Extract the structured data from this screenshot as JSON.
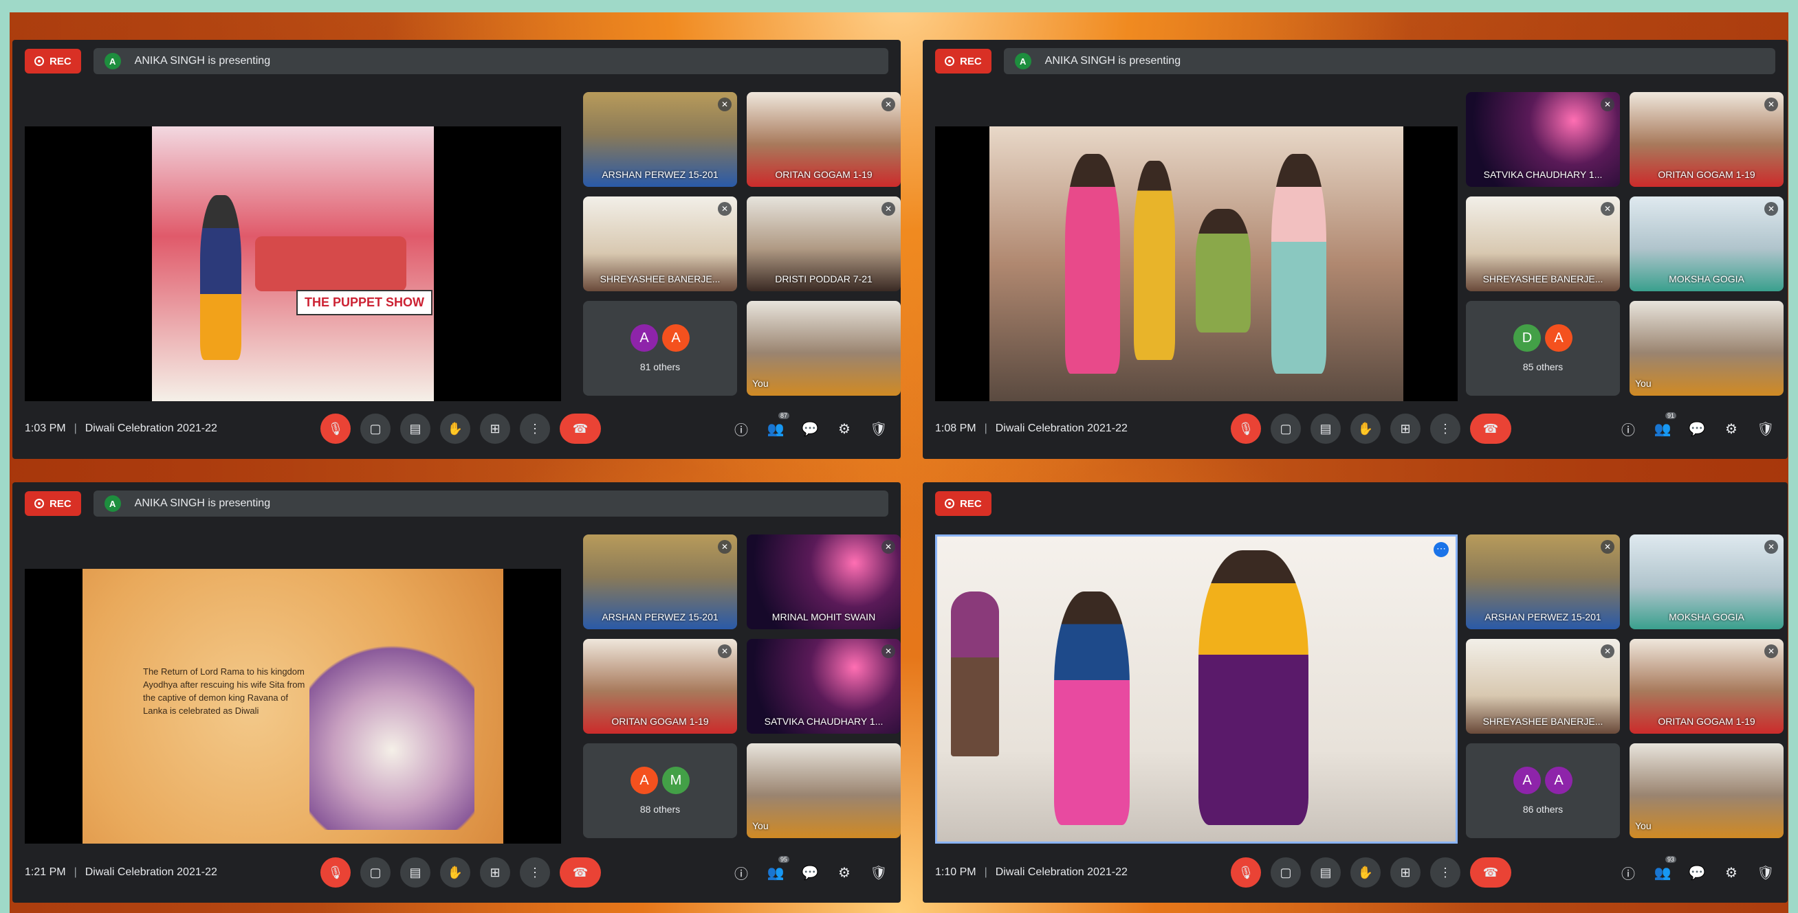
{
  "colors": {
    "rec": "#d93025",
    "end_call": "#ea4335",
    "highlight": "#8ab4f8"
  },
  "icons": {
    "mic_off": "🎙",
    "camera": "▢",
    "captions": "▤",
    "raise_hand": "✋",
    "present": "⊞",
    "more": "⋮",
    "hang_up": "☎",
    "info": "ⓘ",
    "people": "👥",
    "chat": "💬",
    "activities": "⚙",
    "host": "🛡"
  },
  "panels": [
    {
      "rec_label": "REC",
      "presenter_initial": "A",
      "presenting_text": "ANIKA SINGH is presenting",
      "time": "1:03 PM",
      "meeting": "Diwali Celebration 2021-22",
      "participants_badge": "87",
      "tiles": [
        {
          "name": "ARSHAN PERWEZ 15-201"
        },
        {
          "name": "ORITAN GOGAM 1-19"
        },
        {
          "name": "SHREYASHEE BANERJE..."
        },
        {
          "name": "DRISTI PODDAR 7-21"
        },
        {
          "others_text": "81 others",
          "avatars": [
            {
              "letter": "A",
              "color": "#8e24aa"
            },
            {
              "letter": "A",
              "color": "#f4511e"
            }
          ]
        },
        {
          "name": "You"
        }
      ]
    },
    {
      "rec_label": "REC",
      "presenter_initial": "A",
      "presenting_text": "ANIKA SINGH is presenting",
      "time": "1:08 PM",
      "meeting": "Diwali Celebration 2021-22",
      "participants_badge": "91",
      "tiles": [
        {
          "name": "SATVIKA CHAUDHARY 1..."
        },
        {
          "name": "ORITAN GOGAM 1-19"
        },
        {
          "name": "SHREYASHEE BANERJE..."
        },
        {
          "name": "MOKSHA GOGIA"
        },
        {
          "others_text": "85 others",
          "avatars": [
            {
              "letter": "D",
              "color": "#43a047"
            },
            {
              "letter": "A",
              "color": "#f4511e"
            }
          ]
        },
        {
          "name": "You"
        }
      ]
    },
    {
      "rec_label": "REC",
      "presenter_initial": "A",
      "presenting_text": "ANIKA SINGH is presenting",
      "time": "1:21 PM",
      "meeting": "Diwali Celebration 2021-22",
      "participants_badge": "95",
      "story_text": "The Return of Lord Rama to his kingdom Ayodhya after rescuing his wife Sita from the captive of demon king Ravana of Lanka is celebrated as Diwali",
      "tiles": [
        {
          "name": "ARSHAN PERWEZ 15-201"
        },
        {
          "name": "MRINAL MOHIT SWAIN"
        },
        {
          "name": "ORITAN GOGAM 1-19"
        },
        {
          "name": "SATVIKA CHAUDHARY 1..."
        },
        {
          "others_text": "88 others",
          "avatars": [
            {
              "letter": "A",
              "color": "#f4511e"
            },
            {
              "letter": "M",
              "color": "#43a047"
            }
          ]
        },
        {
          "name": "You"
        }
      ]
    },
    {
      "rec_label": "REC",
      "time": "1:10 PM",
      "meeting": "Diwali Celebration 2021-22",
      "participants_badge": "93",
      "tiles": [
        {
          "name": "ARSHAN PERWEZ 15-201"
        },
        {
          "name": "MOKSHA GOGIA"
        },
        {
          "name": "SHREYASHEE BANERJE..."
        },
        {
          "name": "ORITAN GOGAM 1-19"
        },
        {
          "others_text": "86 others",
          "avatars": [
            {
              "letter": "A",
              "color": "#8e24aa"
            },
            {
              "letter": "A",
              "color": "#8e24aa"
            }
          ]
        },
        {
          "name": "You"
        }
      ]
    }
  ]
}
